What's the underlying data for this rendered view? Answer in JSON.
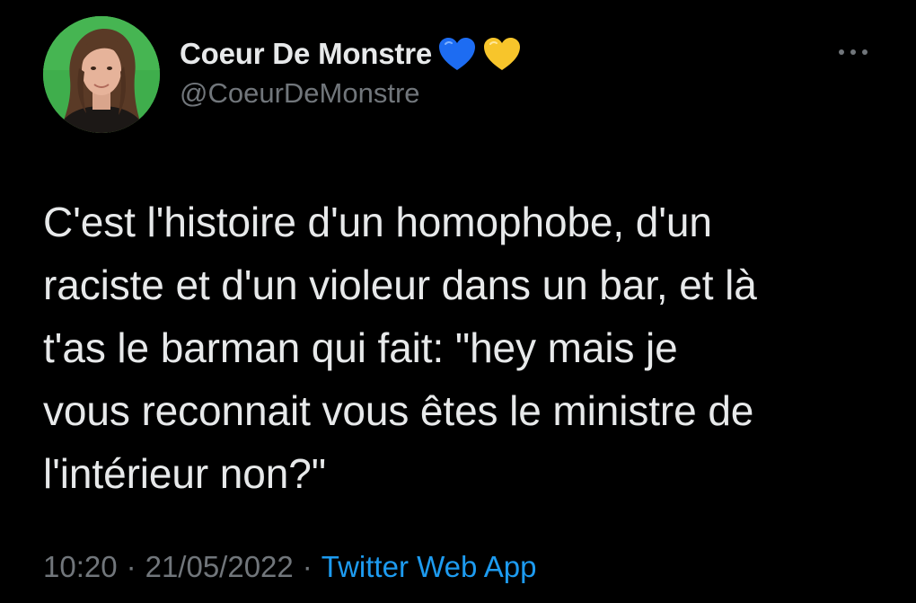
{
  "tweet": {
    "author": {
      "display_name": "Coeur De Monstre",
      "handle": "@CoeurDeMonstre",
      "name_emojis": [
        "blue-heart-icon",
        "yellow-heart-icon"
      ],
      "avatar": "avatar"
    },
    "text": "C'est l'histoire d'un homophobe, d'un\nraciste et d'un violeur dans un bar, et là\nt'as le barman qui fait: \"hey mais je\nvous reconnait vous êtes le ministre de\nl'intérieur non?\"",
    "time": "10:20",
    "separator": "·",
    "date": "21/05/2022",
    "source": "Twitter Web App",
    "more_icon": "more-icon"
  },
  "colors": {
    "background": "#000000",
    "primary_text": "#e7e9ea",
    "secondary_text": "#71767b",
    "link": "#1d9bf0",
    "blue_heart": "#1d6cf2",
    "yellow_heart": "#f7c52b"
  }
}
